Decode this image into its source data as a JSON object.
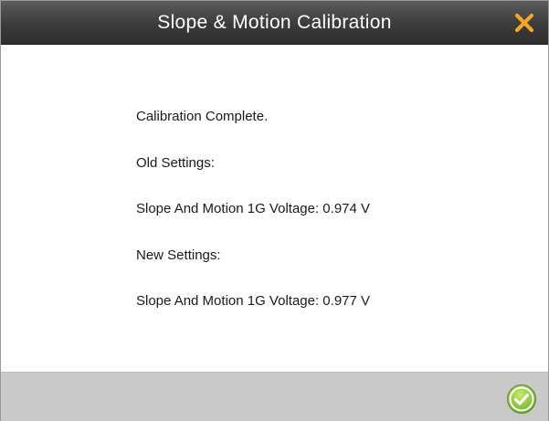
{
  "dialog": {
    "title": "Slope & Motion Calibration",
    "close_icon": "close-icon",
    "accent_color": "#f5a623",
    "ok_icon": "check-circle-icon",
    "ok_color": "#8cc63f"
  },
  "content": {
    "status": "Calibration Complete.",
    "old_heading": "Old Settings:",
    "old_value": "Slope And Motion 1G Voltage: 0.974 V",
    "new_heading": "New Settings:",
    "new_value": "Slope And Motion 1G Voltage: 0.977 V"
  }
}
